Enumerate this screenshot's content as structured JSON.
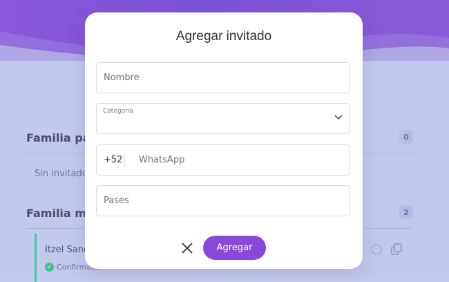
{
  "background": {
    "sections": [
      {
        "title": "Familia pa",
        "count": "0",
        "empty_text": "Sin invitado"
      },
      {
        "title": "Familia ma",
        "count": "2"
      }
    ],
    "guest": {
      "name": "Itzel Sanc",
      "status": "Confirmado"
    }
  },
  "modal": {
    "title": "Agregar invitado",
    "name_placeholder": "Nombre",
    "category_label": "Categoria",
    "category_value": "",
    "phone_prefix": "+52",
    "whatsapp_placeholder": "WhatsApp",
    "passes_placeholder": "Pases",
    "submit_label": "Agregar"
  },
  "colors": {
    "primary": "#8a48d9",
    "header_purple": "#7b55d6",
    "confirmed_green": "#3cbf93"
  }
}
